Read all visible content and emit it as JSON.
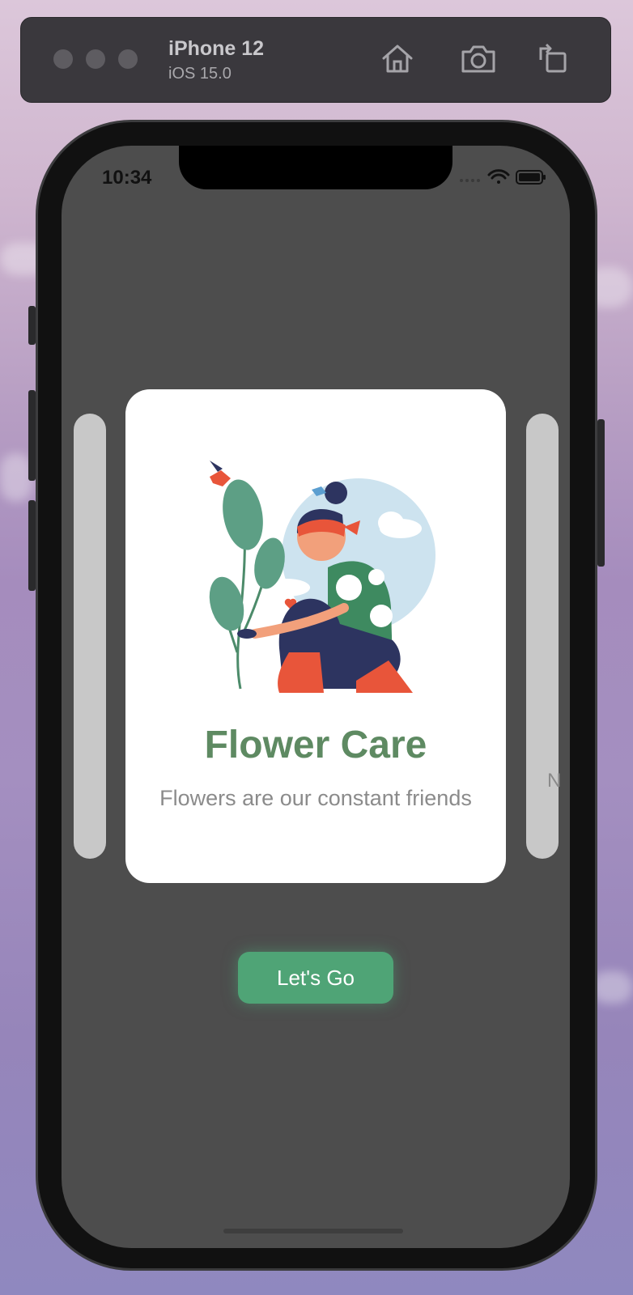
{
  "simulator": {
    "device_name": "iPhone 12",
    "os_version": "iOS 15.0",
    "icons": [
      "home-icon",
      "screenshot-icon",
      "rotate-icon"
    ]
  },
  "status_bar": {
    "time": "10:34",
    "icons": [
      "signal-icon",
      "wifi-icon",
      "battery-icon"
    ]
  },
  "carousel": {
    "current_card": {
      "title": "Flower Care",
      "subtitle": "Flowers are our constant friends",
      "illustration": "girl-planting-flower-illustration"
    },
    "next_card_peek_text": "N"
  },
  "cta": {
    "label": "Let's Go"
  },
  "colors": {
    "screen_bg": "#4d4d4d",
    "card_bg": "#ffffff",
    "title_green": "#5e8a62",
    "button_green": "#4fa476",
    "side_card": "#c8c8c8"
  }
}
